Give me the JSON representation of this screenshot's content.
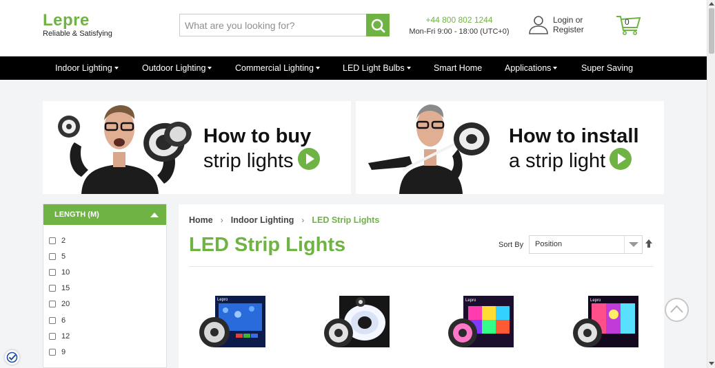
{
  "header": {
    "logo": "Lepre",
    "tagline": "Reliable & Satisfying",
    "search_placeholder": "What are you looking for?",
    "phone": "+44 800 802 1244",
    "hours": "Mon-Fri 9:00 - 18:00 (UTC+0)",
    "login": "Login or",
    "register": "Register",
    "cart_count": "0"
  },
  "nav": {
    "items": [
      {
        "label": "Indoor Lighting",
        "dropdown": true
      },
      {
        "label": "Outdoor Lighting",
        "dropdown": true
      },
      {
        "label": "Commercial Lighting",
        "dropdown": true
      },
      {
        "label": "LED Light Bulbs",
        "dropdown": true
      },
      {
        "label": "Smart Home",
        "dropdown": false
      },
      {
        "label": "Applications",
        "dropdown": true
      },
      {
        "label": "Super Saving",
        "dropdown": false
      }
    ]
  },
  "banners": [
    {
      "line1": "How to buy",
      "line2": "strip lights"
    },
    {
      "line1": "How to install",
      "line2": "a strip light"
    }
  ],
  "filter": {
    "heading": "LENGTH (M)",
    "options": [
      "2",
      "5",
      "10",
      "15",
      "20",
      "6",
      "12",
      "9"
    ]
  },
  "breadcrumb": [
    "Home",
    "Indoor Lighting",
    "LED Strip Lights"
  ],
  "page_title": "LED Strip Lights",
  "sort": {
    "label": "Sort By",
    "selected": "Position"
  },
  "colors": {
    "brand_green": "#6fb344",
    "nav_bg": "#000000"
  }
}
